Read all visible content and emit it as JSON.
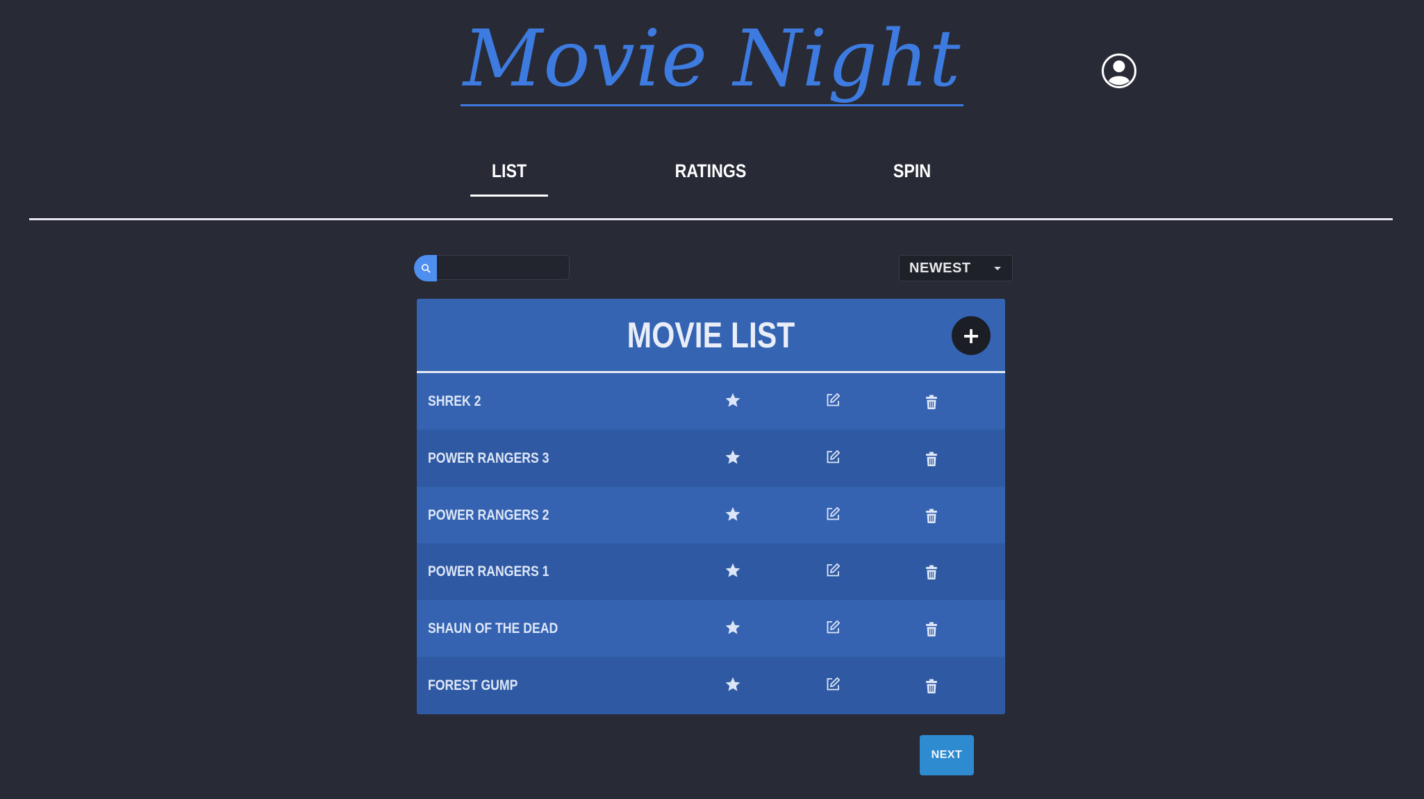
{
  "app": {
    "title": "Movie Night"
  },
  "tabs": [
    {
      "label": "LIST",
      "active": true
    },
    {
      "label": "RATINGS",
      "active": false
    },
    {
      "label": "SPIN",
      "active": false
    }
  ],
  "search": {
    "value": "",
    "placeholder": ""
  },
  "sort": {
    "selected": "NEWEST"
  },
  "movie_list": {
    "title": "MOVIE LIST",
    "add_label": "+",
    "movies": [
      {
        "title": "SHREK 2"
      },
      {
        "title": "POWER RANGERS 3"
      },
      {
        "title": "POWER RANGERS 2"
      },
      {
        "title": "POWER RANGERS 1"
      },
      {
        "title": "SHAUN OF THE DEAD"
      },
      {
        "title": "FOREST GUMP"
      }
    ]
  },
  "pagination": {
    "next_label": "NEXT"
  },
  "colors": {
    "background": "#282a36",
    "accent": "#3d7be0",
    "card": "#2f5ea7",
    "next_button": "#2f8bd0"
  },
  "icons": {
    "profile": "user-circle-icon",
    "search": "search-icon",
    "favorite": "star-icon",
    "edit": "edit-icon",
    "delete": "trash-icon",
    "sort": "caret-down-icon"
  }
}
